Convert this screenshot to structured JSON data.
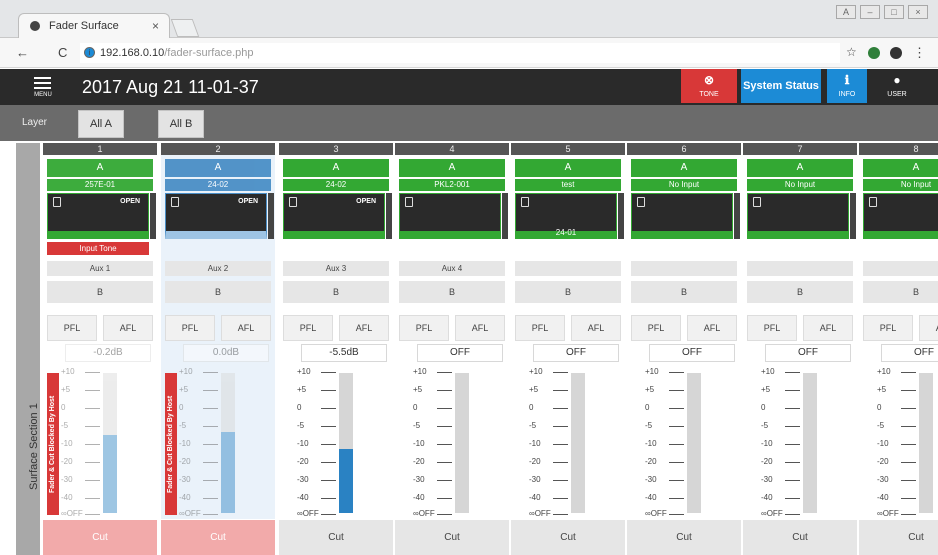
{
  "browser": {
    "tab_title": "Fader Surface",
    "tab_close": "×",
    "url_host": "192.168.0.10",
    "url_path": "/fader-surface.php",
    "window_buttons": [
      "A",
      "–",
      "□",
      "×"
    ]
  },
  "header": {
    "menu_label": "MENU",
    "datetime": "2017 Aug 21 11-01-37",
    "tone_label": "TONE",
    "system_status": "System Status",
    "info_label": "INFO",
    "user_label": "USER"
  },
  "layer": {
    "label": "Layer",
    "buttons": [
      "All A",
      "All B"
    ]
  },
  "section_label": "Surface Section 1",
  "channels": [
    {
      "num": "1",
      "a": "A",
      "name": "257E-01",
      "open": "OPEN",
      "sub": "",
      "tone": "Input Tone",
      "aux": "Aux 1",
      "b": "B",
      "pfl": "PFL",
      "afl": "AFL",
      "gain": "-0.2dB",
      "blocked": "Fader & Cut Blocked By Host",
      "cut": "Cut",
      "level": 0.56,
      "state": "blocked"
    },
    {
      "num": "2",
      "a": "A",
      "name": "24-02",
      "open": "OPEN",
      "sub": "",
      "tone": "",
      "aux": "Aux 2",
      "b": "B",
      "pfl": "PFL",
      "afl": "AFL",
      "gain": "0.0dB",
      "blocked": "Fader & Cut Blocked By Host",
      "cut": "Cut",
      "level": 0.58,
      "state": "selected"
    },
    {
      "num": "3",
      "a": "A",
      "name": "24-02",
      "open": "OPEN",
      "sub": "",
      "tone": "",
      "aux": "Aux 3",
      "b": "B",
      "pfl": "PFL",
      "afl": "AFL",
      "gain": "-5.5dB",
      "blocked": "",
      "cut": "Cut",
      "level": 0.46,
      "state": "normal"
    },
    {
      "num": "4",
      "a": "A",
      "name": "PKL2-001",
      "open": "",
      "sub": "",
      "tone": "",
      "aux": "Aux 4",
      "b": "B",
      "pfl": "PFL",
      "afl": "AFL",
      "gain": "OFF",
      "blocked": "",
      "cut": "Cut",
      "level": 0,
      "state": "normal"
    },
    {
      "num": "5",
      "a": "A",
      "name": "test",
      "open": "",
      "sub": "24-01",
      "tone": "",
      "aux": "",
      "b": "B",
      "pfl": "PFL",
      "afl": "AFL",
      "gain": "OFF",
      "blocked": "",
      "cut": "Cut",
      "level": 0,
      "state": "normal"
    },
    {
      "num": "6",
      "a": "A",
      "name": "No Input",
      "open": "",
      "sub": "",
      "tone": "",
      "aux": "",
      "b": "B",
      "pfl": "PFL",
      "afl": "AFL",
      "gain": "OFF",
      "blocked": "",
      "cut": "Cut",
      "level": 0,
      "state": "normal"
    },
    {
      "num": "7",
      "a": "A",
      "name": "No Input",
      "open": "",
      "sub": "",
      "tone": "",
      "aux": "",
      "b": "B",
      "pfl": "PFL",
      "afl": "AFL",
      "gain": "OFF",
      "blocked": "",
      "cut": "Cut",
      "level": 0,
      "state": "normal"
    },
    {
      "num": "8",
      "a": "A",
      "name": "No Input",
      "open": "",
      "sub": "",
      "tone": "",
      "aux": "",
      "b": "B",
      "pfl": "PFL",
      "afl": "AFL",
      "gain": "OFF",
      "blocked": "",
      "cut": "Cut",
      "level": 0,
      "state": "normal"
    }
  ],
  "scale_ticks": [
    "+10",
    "+5",
    "0",
    "-5",
    "-10",
    "-20",
    "-30",
    "-40",
    "∞OFF"
  ],
  "colors": {
    "green": "#33a833",
    "red": "#d83838",
    "blue": "#1c8bd6",
    "fader": "#2a82c3"
  }
}
